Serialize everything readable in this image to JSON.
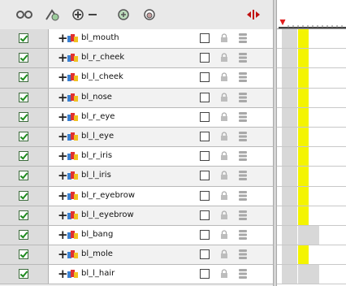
{
  "toolbar": {
    "buttons": [
      {
        "name": "add-drawing-layer",
        "glyph": "⊙⊙"
      },
      {
        "name": "add-peg-layer",
        "glyph": "⚟"
      },
      {
        "name": "expand-collapse",
        "glyph": "⊕⸺"
      },
      {
        "name": "layer-properties",
        "glyph": "◐"
      },
      {
        "name": "show-hide",
        "glyph": "◔"
      }
    ],
    "timeline_toggle_glyph": "⇹"
  },
  "layers": [
    {
      "name": "bl_mouth",
      "yellow": true
    },
    {
      "name": "bl_r_cheek",
      "yellow": true
    },
    {
      "name": "bl_l_cheek",
      "yellow": true
    },
    {
      "name": "bl_nose",
      "yellow": true
    },
    {
      "name": "bl_r_eye",
      "yellow": true
    },
    {
      "name": "bl_l_eye",
      "yellow": true
    },
    {
      "name": "bl_r_iris",
      "yellow": true
    },
    {
      "name": "bl_l_iris",
      "yellow": true
    },
    {
      "name": "bl_r_eyebrow",
      "yellow": true
    },
    {
      "name": "bl_l_eyebrow",
      "yellow": true
    },
    {
      "name": "bl_bang",
      "yellow": false
    },
    {
      "name": "bl_mole",
      "yellow": true
    },
    {
      "name": "bl_l_hair",
      "yellow": false
    }
  ],
  "colors": {
    "playhead": "#e02020",
    "exposure": "#f4f400"
  }
}
